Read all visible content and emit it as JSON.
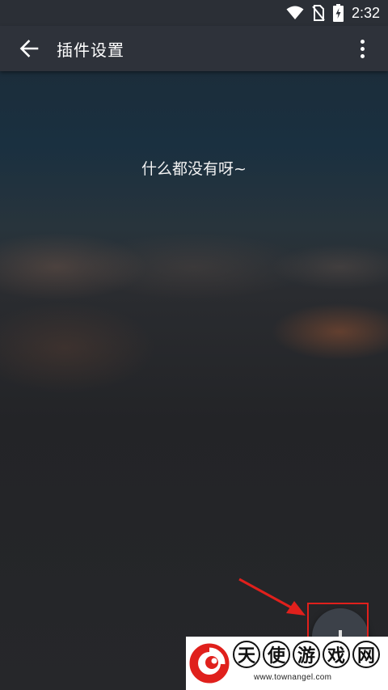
{
  "status_bar": {
    "time": "2:32",
    "icons": [
      "wifi-icon",
      "no-sim-icon",
      "battery-charging-icon"
    ]
  },
  "app_bar": {
    "title": "插件设置",
    "back_icon": "arrow-left-icon",
    "menu_icon": "more-vertical-icon"
  },
  "main": {
    "empty_message": "什么都没有呀~"
  },
  "fab": {
    "icon": "plus-icon"
  },
  "annotation": {
    "color": "#e0201c"
  },
  "watermark": {
    "chars": [
      "天",
      "使",
      "游",
      "戏",
      "网"
    ],
    "url": "www.townangel.com",
    "logo_color": "#e0201c"
  }
}
